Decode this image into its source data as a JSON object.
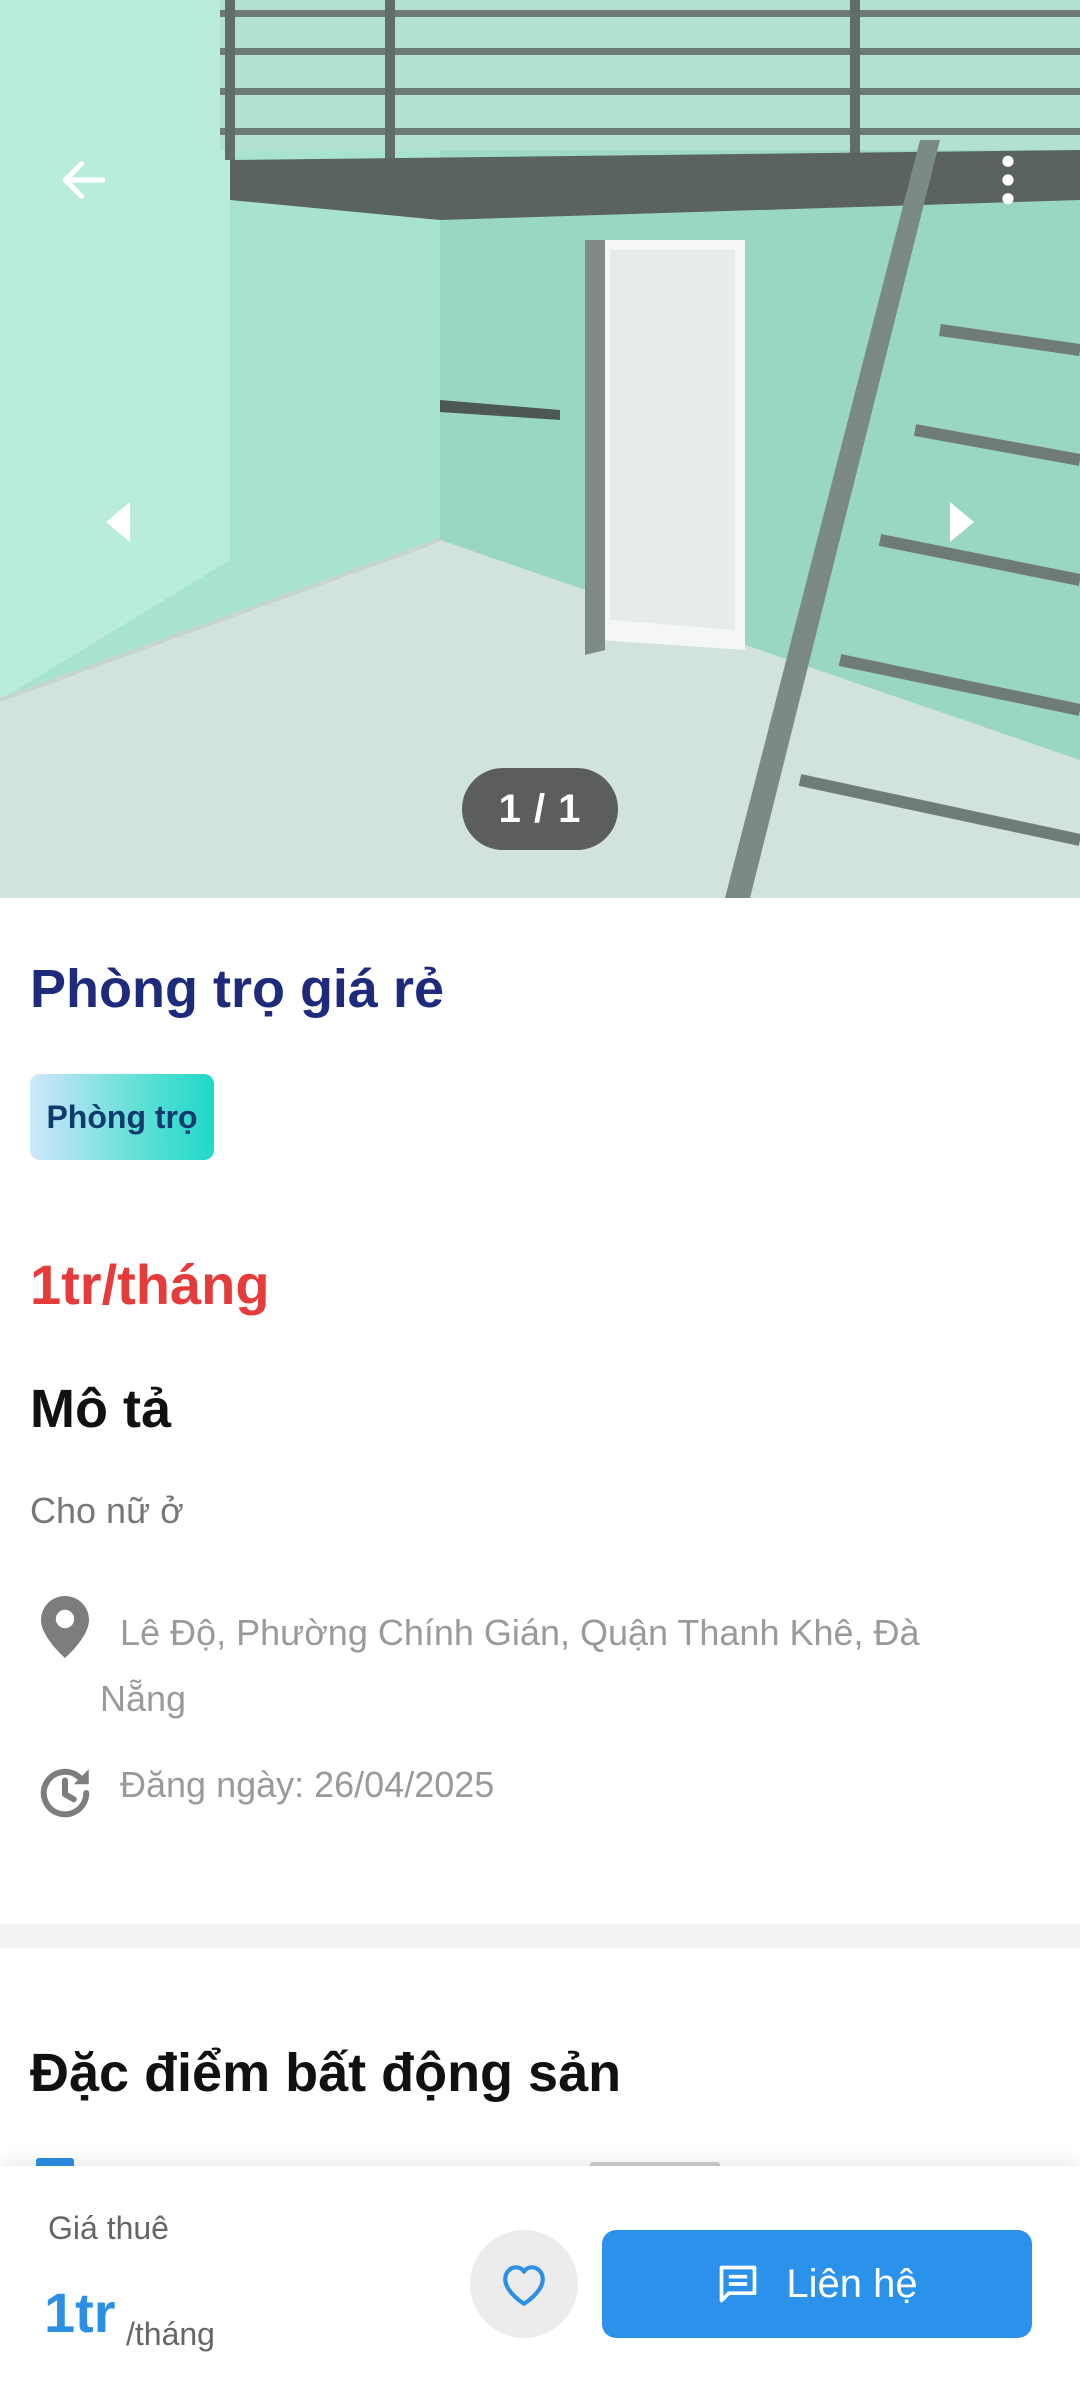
{
  "gallery": {
    "counter": "1 / 1"
  },
  "listing": {
    "title": "Phòng trọ giá rẻ",
    "tag": "Phòng trọ",
    "price": "1tr/tháng",
    "description_heading": "Mô tả",
    "description": "Cho nữ ở",
    "address": "Lê Độ, Phường Chính Gián, Quận Thanh Khê, Đà Nẵng",
    "posted": "Đăng ngày: 26/04/2025"
  },
  "features": {
    "heading": "Đặc điểm bất động sản"
  },
  "bottom_bar": {
    "rent_label": "Giá thuê",
    "rent_value": "1tr",
    "rent_unit": "/tháng",
    "contact_label": "Liên hệ"
  },
  "colors": {
    "title": "#1e2a7c",
    "price": "#e53b3b",
    "accent": "#2b92ec"
  },
  "icons": {
    "back": "arrow-left-icon",
    "more": "more-vertical-icon",
    "prev": "caret-left-icon",
    "next": "caret-right-icon",
    "location": "map-pin-icon",
    "posted": "history-clock-icon",
    "favorite": "heart-icon",
    "contact": "message-icon"
  }
}
